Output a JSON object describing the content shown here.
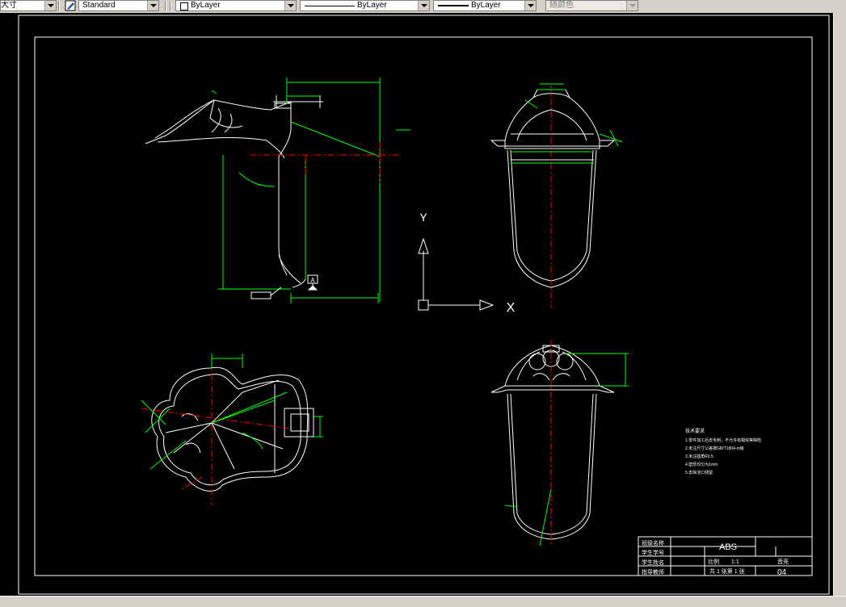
{
  "toolbar": {
    "dim_style_label": "大寸",
    "text_style_value": "Standard",
    "layer_value": "ByLayer",
    "linetype_value": "ByLayer",
    "lineweight_value": "ByLayer",
    "plotstyle_value": "随颜色"
  },
  "drawing": {
    "ucs_y": "Y",
    "ucs_x": "X",
    "datum_label": "A",
    "notes_title": "技术要求",
    "notes": [
      "1.零件加工后去毛刺，不允许有裂纹等缺陷",
      "2.未注尺寸公差按GB/T1804-m级",
      "3.未注圆角R0.5",
      "4.壁厚均匀为1mm",
      "5.去除浇口残留"
    ],
    "title_block": {
      "material": "ABS",
      "scale_label": "比例",
      "scale_value": "1:1",
      "sheet_text": "共 1 张第 1 张",
      "part_name": "音壳",
      "drawing_no": "04",
      "rows": [
        "班级名称",
        "学生学号",
        "学生姓名",
        "指导教师"
      ]
    }
  },
  "colors": {
    "background": "#000000",
    "outline": "#ffffff",
    "dimension": "#00ff00",
    "centerline": "#ff0000",
    "toolbar": "#d4d0c8"
  }
}
